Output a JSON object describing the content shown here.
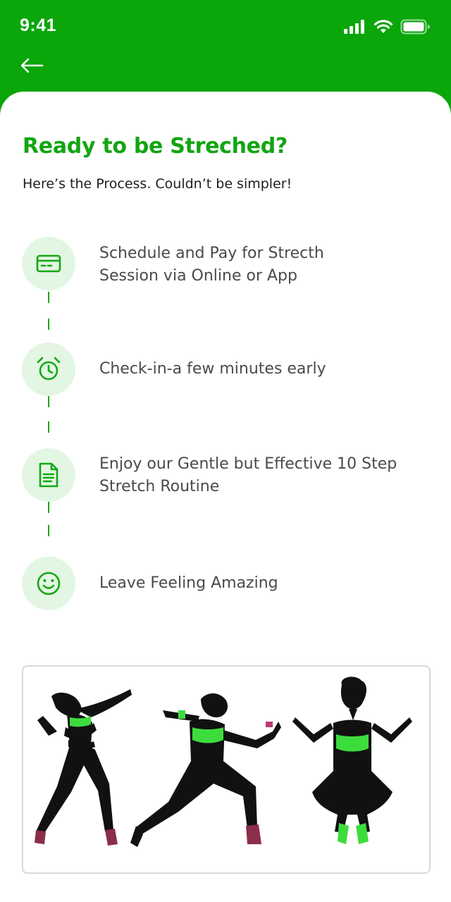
{
  "status_bar": {
    "time": "9:41",
    "icons": [
      "signal-icon",
      "wifi-icon",
      "battery-icon"
    ]
  },
  "header": {
    "back_icon": "arrow-left-icon"
  },
  "content": {
    "title": "Ready to be Streched?",
    "subtitle": "Here’s the Process. Couldn’t be simpler!"
  },
  "steps": [
    {
      "icon": "credit-card-icon",
      "line1": "Schedule and Pay for Strecth",
      "line2": "Session via Online or App"
    },
    {
      "icon": "alarm-clock-icon",
      "line1": "Check-in-a few minutes early",
      "line2": ""
    },
    {
      "icon": "document-icon",
      "line1": "Enjoy our Gentle but Effective 10 Step",
      "line2": "Stretch Routine"
    },
    {
      "icon": "smile-icon",
      "line1": "Leave Feeling Amazing",
      "line2": ""
    }
  ],
  "colors": {
    "brand_green": "#0aa60a",
    "title_green": "#12a512",
    "circle_bg": "#e3f6e3",
    "accent_green": "#3ddc3d"
  },
  "gallery": {
    "image": "fitness-silhouettes-image"
  }
}
